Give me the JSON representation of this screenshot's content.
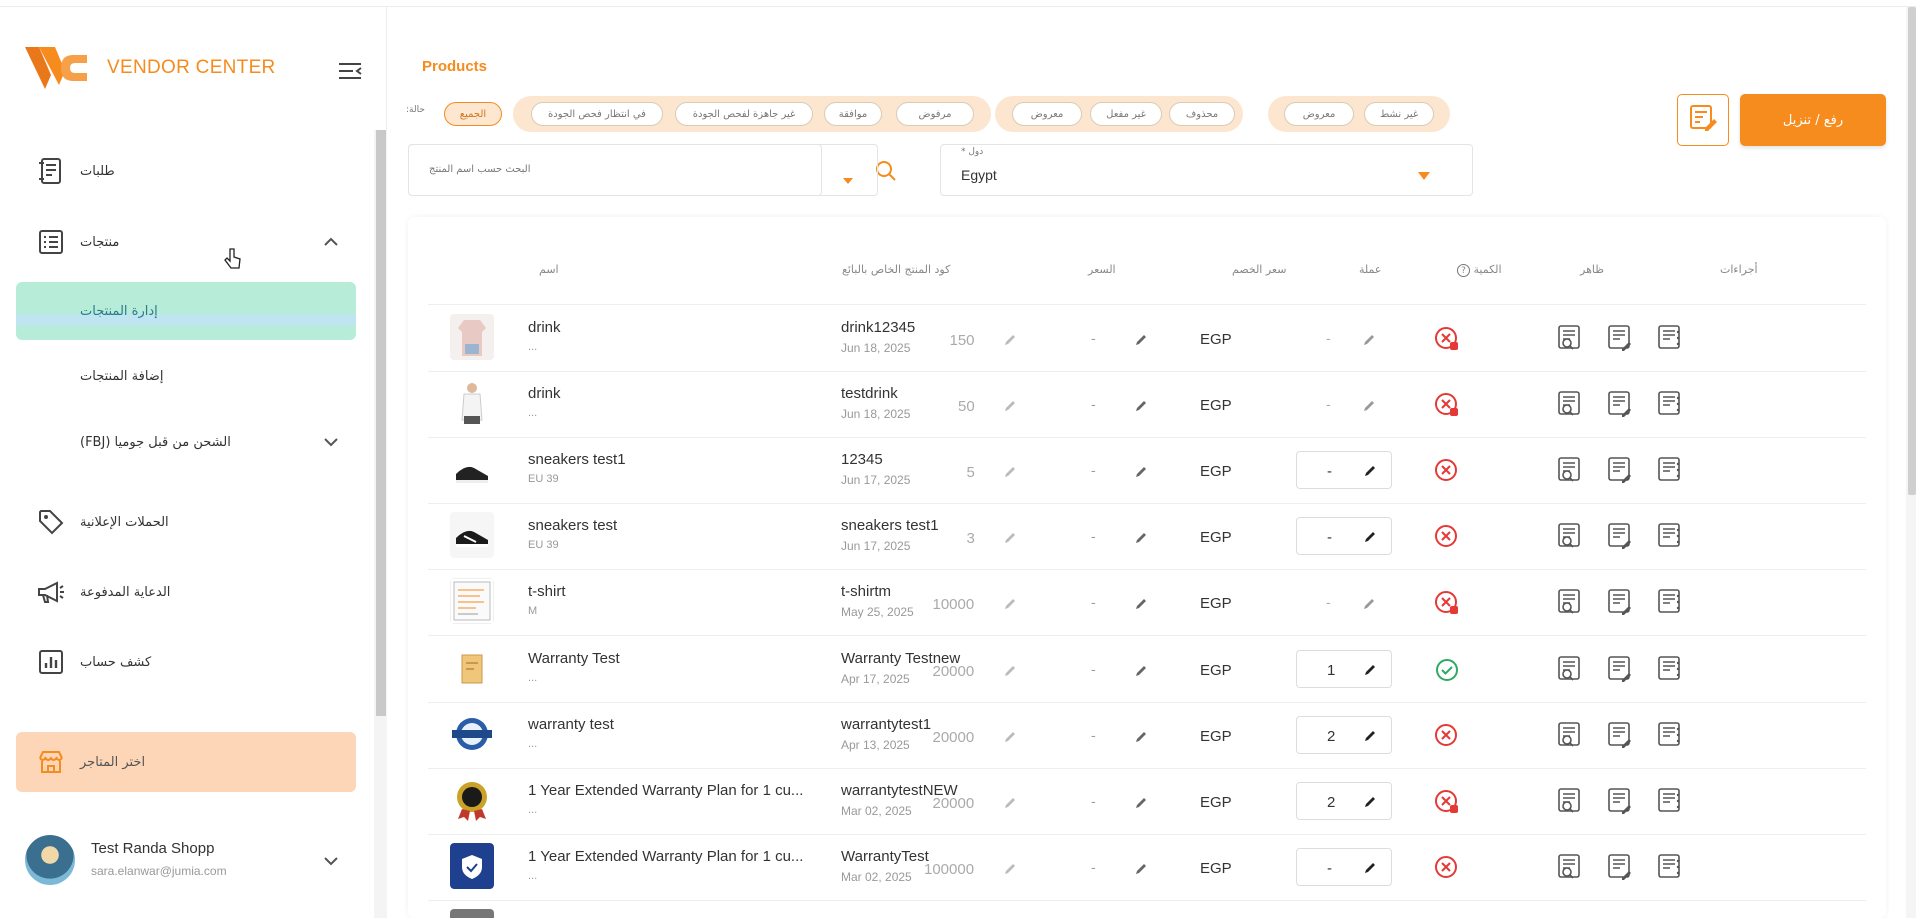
{
  "brand": {
    "name": "VENDOR CENTER",
    "accent": "#f68b1e"
  },
  "sidebar": {
    "orders": "طلبات",
    "products": "منتجات",
    "manage_products": "إدارة المنتجات",
    "add_products": "إضافة المنتجات",
    "fbj": "الشحن من قبل جوميا (FBJ)",
    "campaigns": "الحملات الإعلانية",
    "sponsored_ads": "الدعاية المدفوعة",
    "account_statement": "كشف حساب",
    "choose_stores": "اختر المتاجر"
  },
  "user": {
    "name": "Test Randa Shopp",
    "email": "sara.elanwar@jumia.com"
  },
  "header": {
    "title": "Products",
    "status_label": "حالة:",
    "chips": {
      "all": "الجميع",
      "pending_qc": "في انتظار فحص الجودة",
      "not_ready_qc": "غير جاهزة لفحص الجودة",
      "approved": "موافقة",
      "rejected": "مرفوض",
      "shown": "معروض",
      "disabled": "غير مفعل",
      "deleted": "محذوف",
      "shown2": "معروض",
      "inactive": "غير نشط"
    },
    "search_placeholder": "البحث حسب اسم المنتج",
    "country_label": "دول *",
    "country_value": "Egypt",
    "upload_button": "رفع / تنزيل"
  },
  "table": {
    "columns": {
      "name": "اسم",
      "seller_sku": "كود المنتج الخاص بالبائع",
      "price": "السعر",
      "sale_price": "سعر الخصم",
      "currency": "عملة",
      "quantity": "الكمية",
      "visible": "ظاهر",
      "actions": "أجراءات"
    },
    "rows": [
      {
        "name": "drink",
        "sub": "...",
        "code": "drink12345",
        "date": "Jun 18, 2025",
        "price": "150",
        "sale": "-",
        "currency": "EGP",
        "qty": "-",
        "qty_boxed": false,
        "visible": "hidden-pending",
        "thumb": "shirt"
      },
      {
        "name": "drink",
        "sub": "...",
        "code": "testdrink",
        "date": "Jun 18, 2025",
        "price": "50",
        "sale": "-",
        "currency": "EGP",
        "qty": "-",
        "qty_boxed": false,
        "visible": "hidden-pending",
        "thumb": "tank"
      },
      {
        "name": "sneakers test1",
        "sub": "EU 39",
        "code": "12345",
        "date": "Jun 17, 2025",
        "price": "5",
        "sale": "-",
        "currency": "EGP",
        "qty": "-",
        "qty_boxed": true,
        "visible": "hidden",
        "thumb": "shoe"
      },
      {
        "name": "sneakers test",
        "sub": "EU 39",
        "code": "sneakers test1",
        "date": "Jun 17, 2025",
        "price": "3",
        "sale": "-",
        "currency": "EGP",
        "qty": "-",
        "qty_boxed": true,
        "visible": "hidden",
        "thumb": "shoe2"
      },
      {
        "name": "t-shirt",
        "sub": "M",
        "code": "t-shirtm",
        "date": "May 25, 2025",
        "price": "10000",
        "sale": "-",
        "currency": "EGP",
        "qty": "-",
        "qty_boxed": false,
        "visible": "hidden-pending",
        "thumb": "doc"
      },
      {
        "name": "Warranty Test",
        "sub": "...",
        "code": "Warranty Testnew",
        "date": "Apr 17, 2025",
        "price": "20000",
        "sale": "-",
        "currency": "EGP",
        "qty": "1",
        "qty_boxed": true,
        "visible": "shown",
        "thumb": "box"
      },
      {
        "name": "warranty test",
        "sub": "...",
        "code": "warrantytest1",
        "date": "Apr 13, 2025",
        "price": "20000",
        "sale": "-",
        "currency": "EGP",
        "qty": "2",
        "qty_boxed": true,
        "visible": "hidden",
        "thumb": "badge"
      },
      {
        "name": "1 Year Extended Warranty Plan for 1 cu...",
        "sub": "...",
        "code": "warrantytestNEW",
        "date": "Mar 02, 2025",
        "price": "20000",
        "sale": "-",
        "currency": "EGP",
        "qty": "2",
        "qty_boxed": true,
        "visible": "hidden-pending",
        "thumb": "seal"
      },
      {
        "name": "1 Year Extended Warranty Plan for 1 cu...",
        "sub": "...",
        "code": "WarrantyTest",
        "date": "Mar 02, 2025",
        "price": "100000",
        "sale": "-",
        "currency": "EGP",
        "qty": "-",
        "qty_boxed": true,
        "visible": "hidden",
        "thumb": "shield"
      }
    ]
  },
  "colors": {
    "danger": "#e53935",
    "success": "#2eaa62",
    "active_sub": "#b6ecd8",
    "store_bg": "#fdd5b7"
  }
}
